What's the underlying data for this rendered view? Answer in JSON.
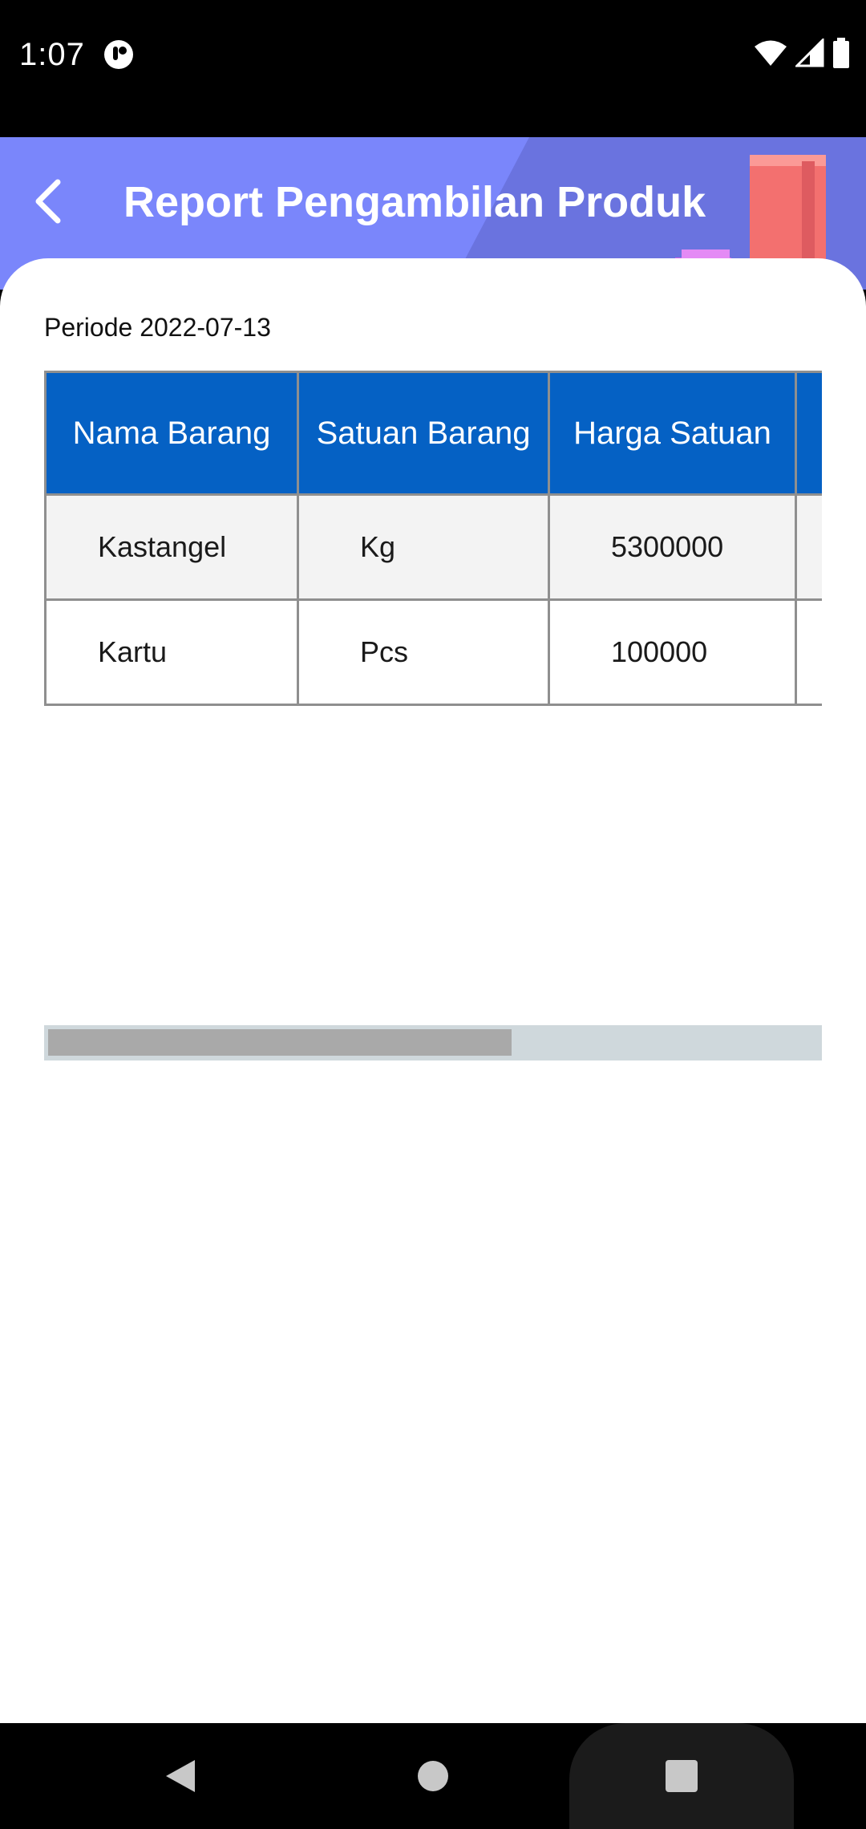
{
  "status_bar": {
    "time": "1:07",
    "app_icon": "notification-app-icon",
    "icons": [
      "wifi-icon",
      "cellular-signal-icon",
      "battery-icon"
    ]
  },
  "header": {
    "title": "Report Pengambilan Produk",
    "back_icon": "chevron-left-icon",
    "background_color": "#7a86fb",
    "decor_color": "#6a73df"
  },
  "report": {
    "periode_label": "Periode 2022-07-13",
    "table": {
      "header_color": "#0561c4",
      "columns": [
        "Nama Barang",
        "Satuan Barang",
        "Harga Satuan",
        ""
      ],
      "rows": [
        {
          "nama": "Kastangel",
          "satuan": "Kg",
          "harga": "5300000",
          "extra": ""
        },
        {
          "nama": "Kartu",
          "satuan": "Pcs",
          "harga": "100000",
          "extra": ""
        }
      ]
    },
    "horizontal_scroll_position": 0
  },
  "nav_bar": {
    "icons": [
      "back-triangle-icon",
      "home-circle-icon",
      "recents-square-icon"
    ]
  }
}
